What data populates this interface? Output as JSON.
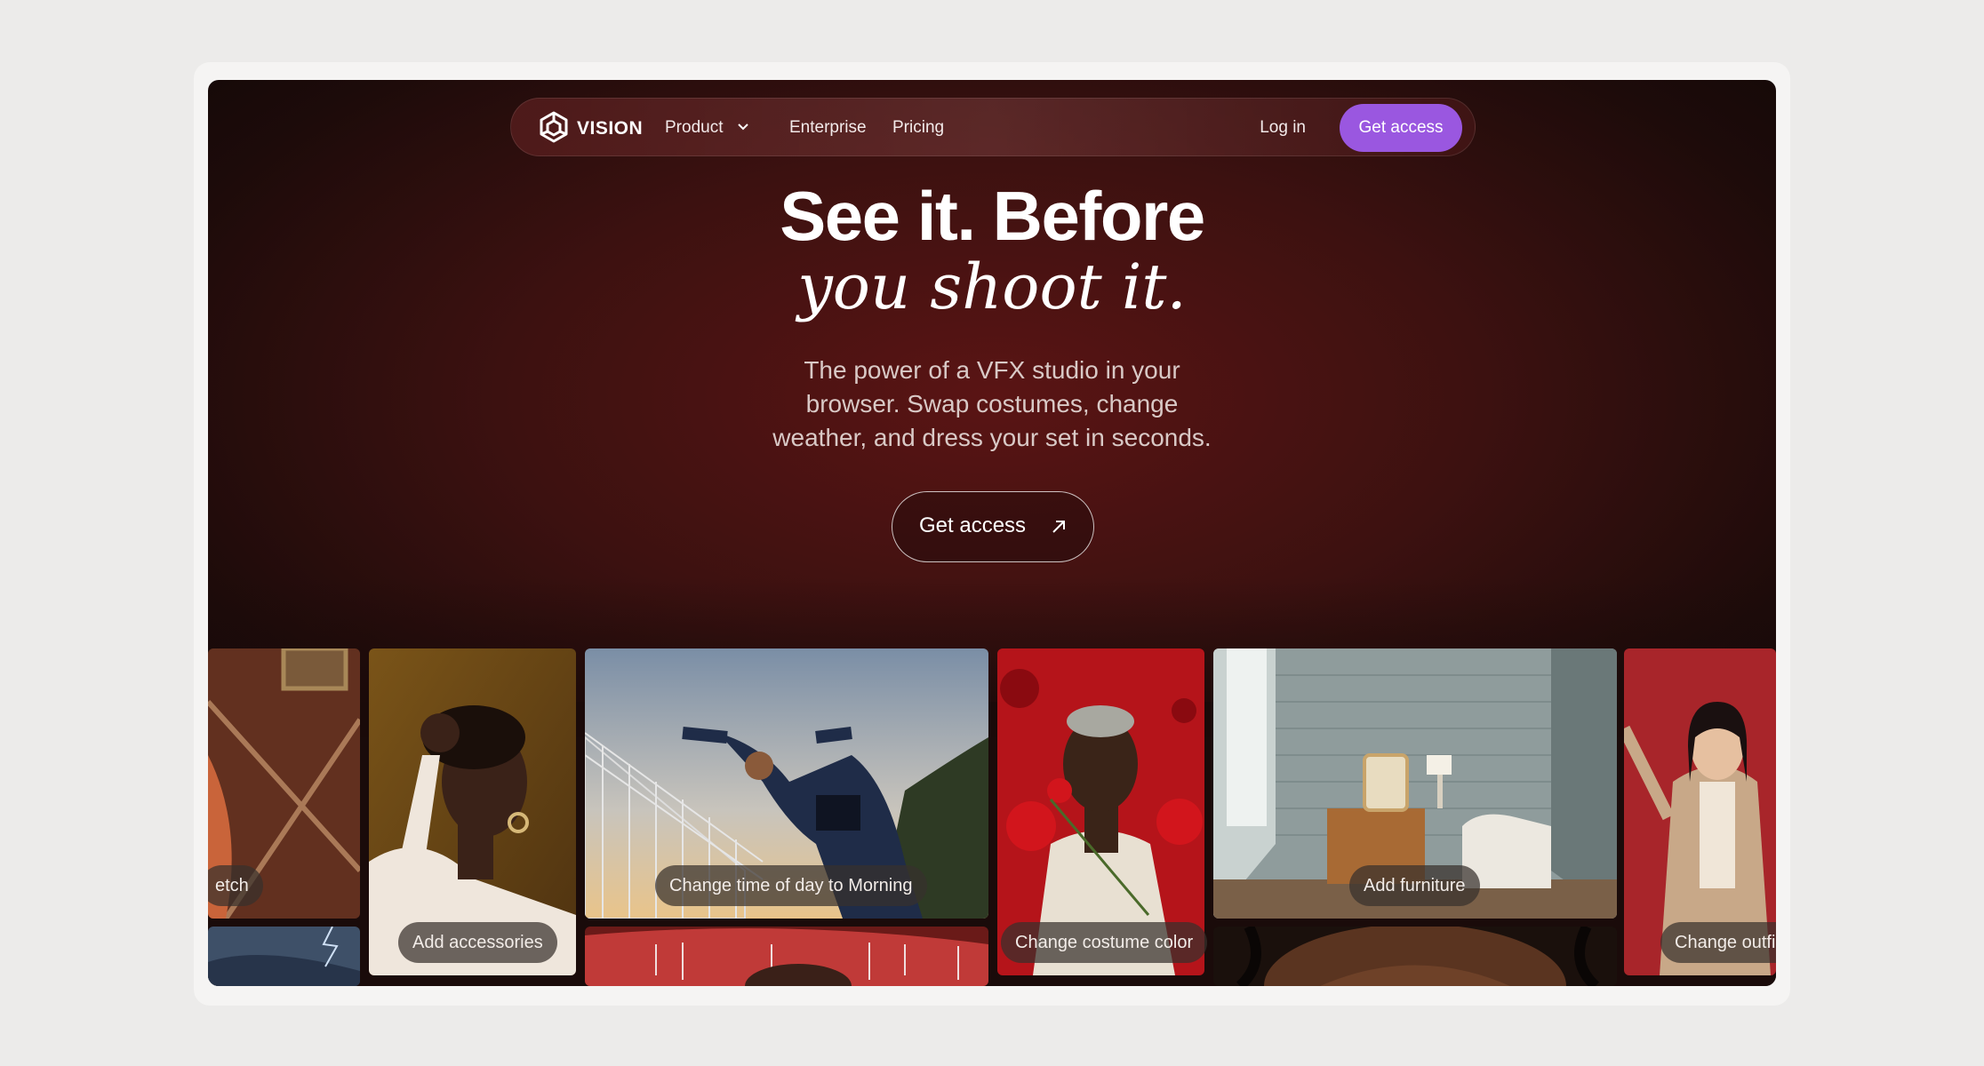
{
  "nav": {
    "brand": "VISION",
    "product_label": "Product",
    "enterprise_label": "Enterprise",
    "pricing_label": "Pricing",
    "login_label": "Log in",
    "cta_label": "Get access",
    "cta_color": "#9a57e0"
  },
  "hero": {
    "title": "See it. Before",
    "title_italic": "you shoot it.",
    "description": "The power of a VFX studio in your browser. Swap costumes, change weather, and dress your set in seconds.",
    "cta_label": "Get access",
    "cta_icon": "arrow-up-right-icon"
  },
  "gallery": {
    "chips": {
      "sketch": "etch",
      "accessories": "Add accessories",
      "morning": "Change time of day to Morning",
      "costume": "Change costume color",
      "furniture": "Add furniture",
      "outfit": "Change outfi"
    }
  }
}
